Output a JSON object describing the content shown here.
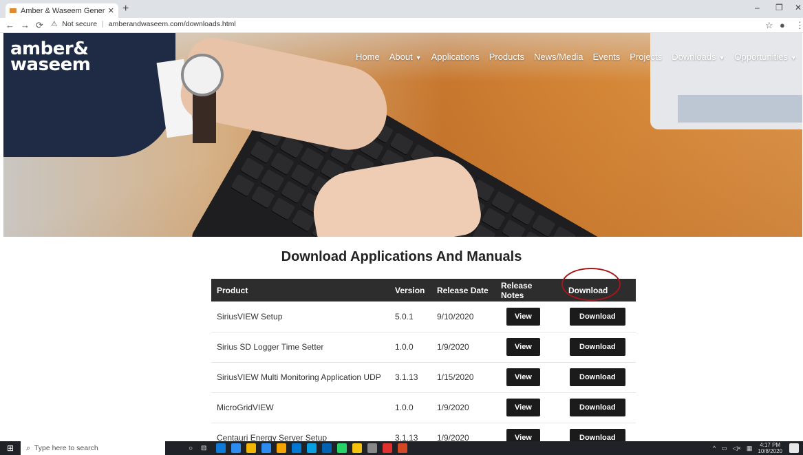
{
  "browser": {
    "tab_title": "Amber & Waseem General Tradin",
    "tab_close": "✕",
    "new_tab": "+",
    "security_label": "Not secure",
    "url": "amberandwaseem.com/downloads.html",
    "window_controls": [
      "–",
      "❐",
      "✕"
    ]
  },
  "site": {
    "logo_line1": "amber&",
    "logo_line2": "waseem",
    "nav": [
      {
        "label": "Home",
        "dropdown": false
      },
      {
        "label": "About",
        "dropdown": true
      },
      {
        "label": "Applications",
        "dropdown": false
      },
      {
        "label": "Products",
        "dropdown": false
      },
      {
        "label": "News/Media",
        "dropdown": false
      },
      {
        "label": "Events",
        "dropdown": false
      },
      {
        "label": "Projects",
        "dropdown": false
      },
      {
        "label": "Downloads",
        "dropdown": true
      },
      {
        "label": "Opportunities",
        "dropdown": true
      }
    ]
  },
  "downloads": {
    "heading": "Download Applications And Manuals",
    "columns": [
      "Product",
      "Version",
      "Release Date",
      "Release Notes",
      "Download"
    ],
    "rows": [
      {
        "product": "SiriusVIEW Setup",
        "version": "5.0.1",
        "date": "9/10/2020",
        "notes_btn": "View",
        "download_btn": "Download"
      },
      {
        "product": "Sirius SD Logger Time Setter",
        "version": "1.0.0",
        "date": "1/9/2020",
        "notes_btn": "View",
        "download_btn": "Download"
      },
      {
        "product": "SiriusVIEW Multi Monitoring Application UDP",
        "version": "3.1.13",
        "date": "1/15/2020",
        "notes_btn": "View",
        "download_btn": "Download"
      },
      {
        "product": "MicroGridVIEW",
        "version": "1.0.0",
        "date": "1/9/2020",
        "notes_btn": "View",
        "download_btn": "Download"
      },
      {
        "product": "Centauri Energy Server Setup",
        "version": "3.1.13",
        "date": "1/9/2020",
        "notes_btn": "View",
        "download_btn": "Download"
      }
    ],
    "highlight_color": "#a4161a"
  },
  "taskbar": {
    "search_placeholder": "Type here to search",
    "time": "4:17 PM",
    "date": "10/8/2020",
    "icon_colors": [
      "#0f7bd8",
      "#2d8cf0",
      "#f2b600",
      "#2d8cf0",
      "#f4a300",
      "#0078d4",
      "#0a9fe0",
      "#0063b1",
      "#25d366",
      "#f4c20d",
      "#888888",
      "#e0312f",
      "#d24726"
    ]
  }
}
